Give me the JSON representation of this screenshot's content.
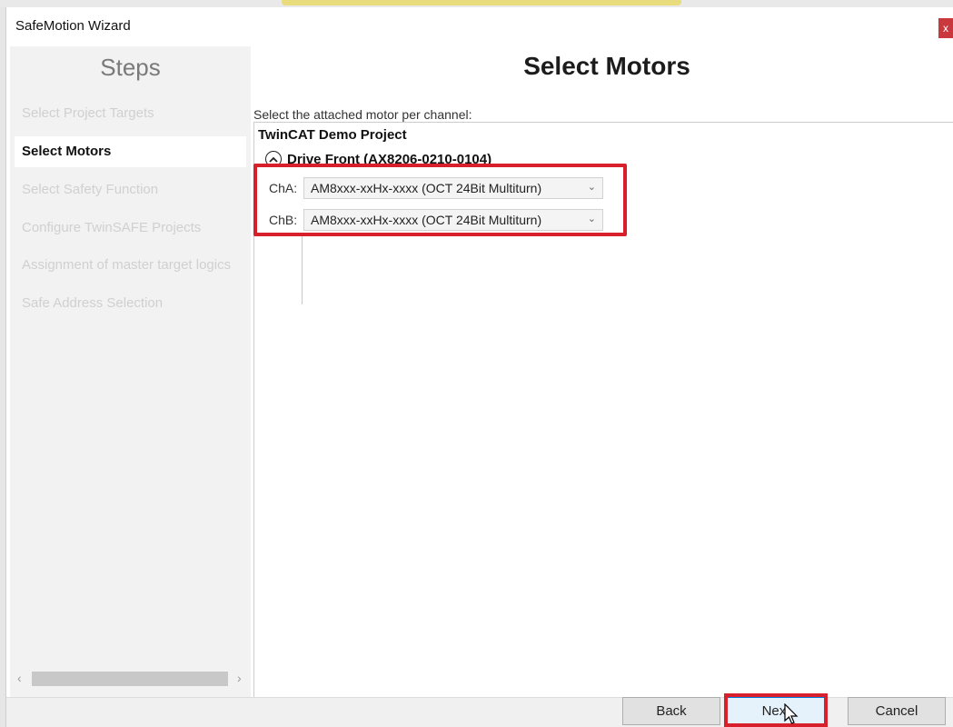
{
  "window": {
    "title": "SafeMotion Wizard",
    "close_glyph": "x"
  },
  "sidebar": {
    "title": "Steps",
    "steps": [
      {
        "label": "Select Project Targets",
        "active": false
      },
      {
        "label": "Select Motors",
        "active": true
      },
      {
        "label": "Select Safety Function",
        "active": false
      },
      {
        "label": "Configure TwinSAFE Projects",
        "active": false
      },
      {
        "label": "Assignment of master target logics",
        "active": false
      },
      {
        "label": "Safe Address Selection",
        "active": false
      }
    ],
    "scroll_left": "‹",
    "scroll_right": "›"
  },
  "main": {
    "title": "Select Motors",
    "instruction": "Select the attached motor per channel:",
    "project": "TwinCAT Demo Project",
    "drive": "Drive Front (AX8206-0210-0104)",
    "channels": [
      {
        "label": "ChA:",
        "value": "AM8xxx-xxHx-xxxx (OCT 24Bit Multiturn)"
      },
      {
        "label": "ChB:",
        "value": "AM8xxx-xxHx-xxxx (OCT 24Bit Multiturn)"
      }
    ]
  },
  "buttons": {
    "back": "Back",
    "next": "Next",
    "cancel": "Cancel"
  },
  "colors": {
    "highlight": "#d8202d",
    "close_button": "#c8383d",
    "sidebar_bg": "#f2f2f2"
  },
  "icons": {
    "collapse": "chevron-up-circle-icon",
    "dropdown": "chevron-down-icon",
    "cursor": "mouse-pointer-icon"
  }
}
